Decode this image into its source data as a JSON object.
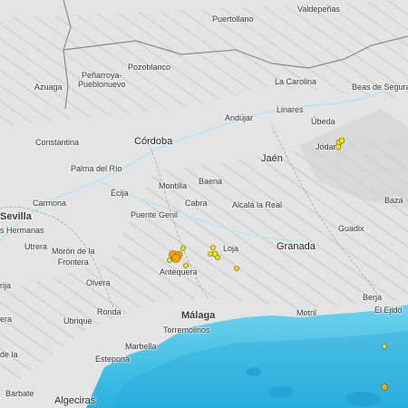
{
  "map": {
    "colors": {
      "land": "#e4e4e4",
      "sea": "#4fc6e6",
      "river": "#b9e4f0",
      "border": "#8a8a8a",
      "quake_small": "#f2e600",
      "quake_large": "#f5a300"
    },
    "places": {
      "puertollano": "Puertollano",
      "valdepenas": "Valdepeñas",
      "penarroya": "Peñarroya-\nPueblonuevo",
      "pozoblanco": "Pozoblanco",
      "azuaga": "Azuaga",
      "la_carolina": "La Carolina",
      "beas": "Beas de Segura",
      "linares": "Linares",
      "andujar": "Andújar",
      "ubeda": "Úbeda",
      "constantina": "Constantina",
      "cordoba": "Córdoba",
      "jodar": "Jódar",
      "palma": "Palma del Río",
      "jaen": "Jaén",
      "baena": "Baena",
      "montilla": "Montilla",
      "ecija": "Écija",
      "carmona": "Carmona",
      "cabra": "Cabra",
      "alcala": "Alcalá la Real",
      "baza": "Baza",
      "sevilla": "Sevilla",
      "puente_genil": "Puente Genil",
      "hermanas": "s Hermanas",
      "guadix": "Guadix",
      "utrera": "Utrera",
      "moron": "Morón de la\nFrontera",
      "loja": "Loja",
      "granada": "Granada",
      "antequera": "Antequera",
      "osuna": "rija",
      "olvera": "Olvera",
      "berja": "Berja",
      "el_ejido": "El Ejido",
      "ronda": "Ronda",
      "ubrique": "Ubrique",
      "malaga": "Málaga",
      "motril": "Motril",
      "torremolinos": "Torremolinos",
      "era": "era",
      "marbella": "Marbella",
      "de_la": "de la",
      "estepona": "Estepona",
      "barbate": "Barbate",
      "algeciras": "Algeciras"
    },
    "earthquakes": [
      {
        "name": "jodar-1",
        "magnitude_class": "small"
      },
      {
        "name": "jodar-2",
        "magnitude_class": "small"
      },
      {
        "name": "jodar-3",
        "magnitude_class": "small"
      },
      {
        "name": "antequera-1",
        "magnitude_class": "large"
      },
      {
        "name": "antequera-2",
        "magnitude_class": "large"
      },
      {
        "name": "antequera-3",
        "magnitude_class": "large"
      },
      {
        "name": "antequera-4",
        "magnitude_class": "small"
      },
      {
        "name": "antequera-5",
        "magnitude_class": "small"
      },
      {
        "name": "antequera-6",
        "magnitude_class": "small"
      },
      {
        "name": "loja-1",
        "magnitude_class": "small"
      },
      {
        "name": "loja-2",
        "magnitude_class": "small"
      },
      {
        "name": "loja-3",
        "magnitude_class": "small"
      },
      {
        "name": "loja-4",
        "magnitude_class": "small"
      },
      {
        "name": "loja-5",
        "magnitude_class": "small"
      },
      {
        "name": "alboran-1",
        "magnitude_class": "small"
      },
      {
        "name": "alboran-2",
        "magnitude_class": "large"
      }
    ]
  }
}
